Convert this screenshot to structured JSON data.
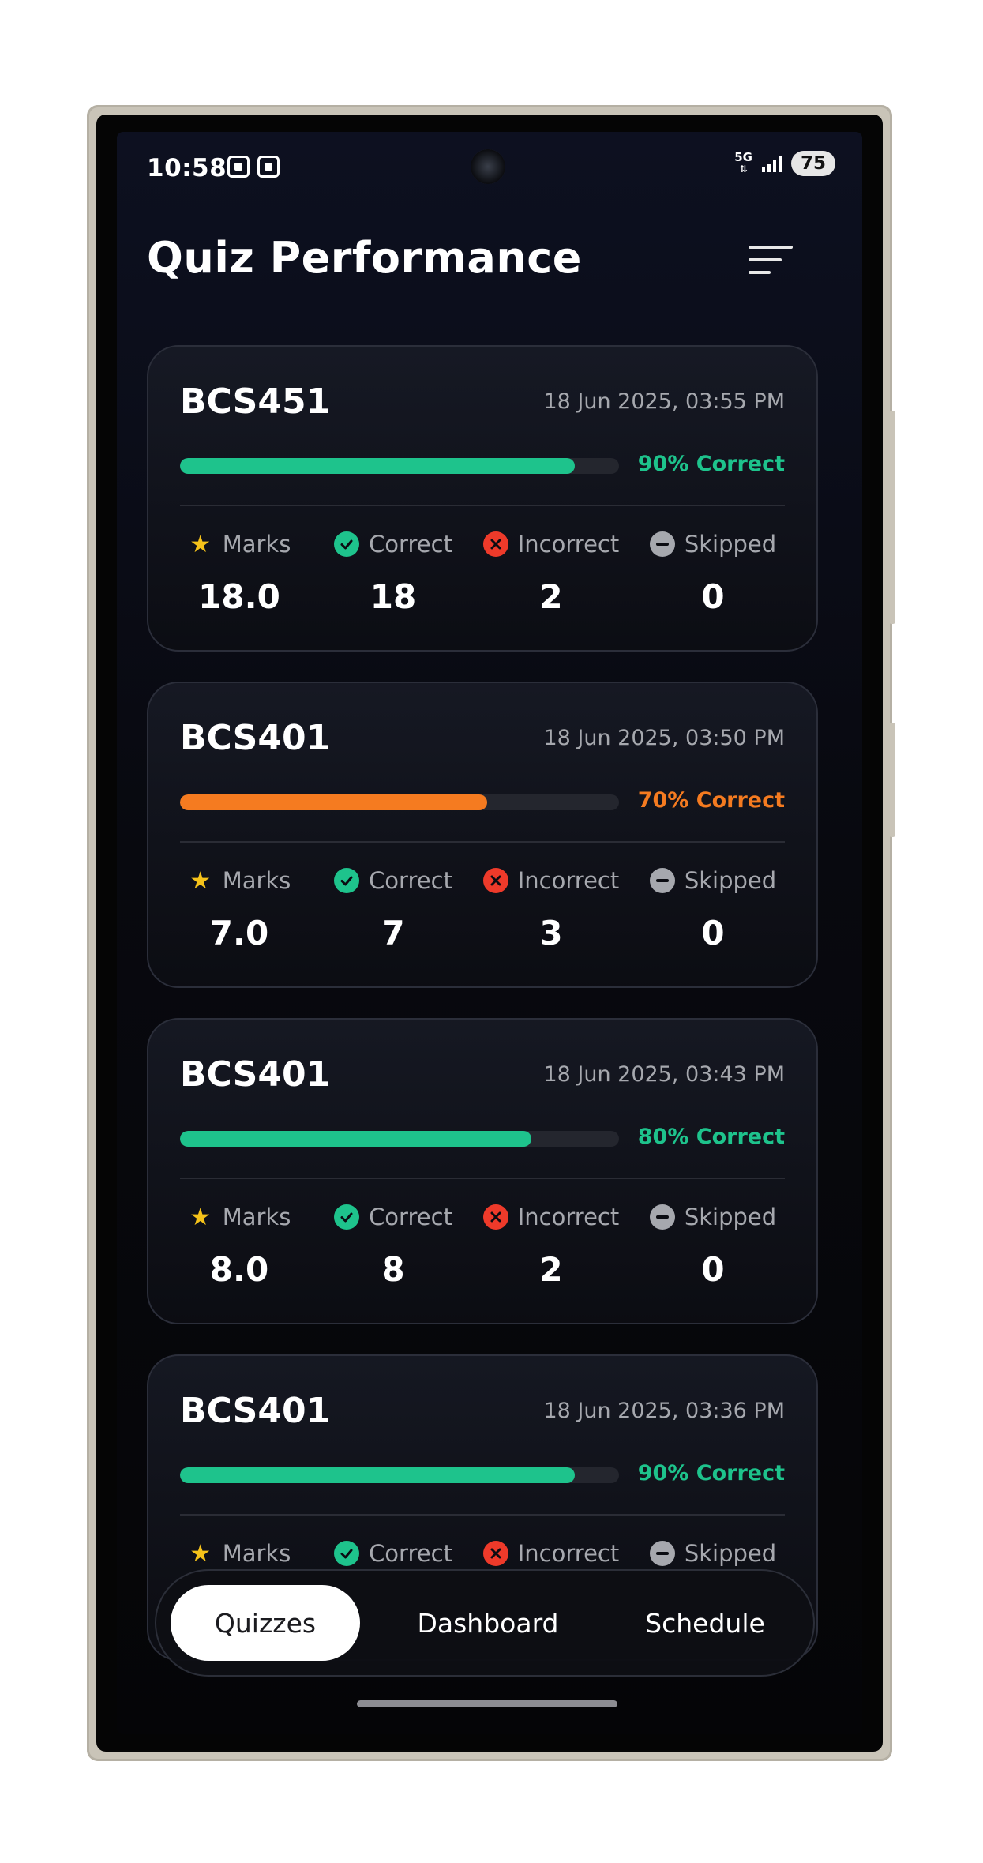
{
  "status_bar": {
    "time": "10:58",
    "network": "5G",
    "battery": "75"
  },
  "header": {
    "title": "Quiz Performance",
    "filter_icon": "filter-lines-icon"
  },
  "stat_labels": {
    "marks": "Marks",
    "correct": "Correct",
    "incorrect": "Incorrect",
    "skipped": "Skipped"
  },
  "colors": {
    "green": "#1ec38c",
    "orange": "#f57b20",
    "red": "#ee3a2a",
    "star": "#f5c21a"
  },
  "quizzes": [
    {
      "code": "BCS451",
      "date": "18 Jun 2025, 03:55 PM",
      "percent": 90,
      "progress_label": "90% Correct",
      "status": "green",
      "marks": "18.0",
      "correct": "18",
      "incorrect": "2",
      "skipped": "0"
    },
    {
      "code": "BCS401",
      "date": "18 Jun 2025, 03:50 PM",
      "percent": 70,
      "progress_label": "70% Correct",
      "status": "orange",
      "marks": "7.0",
      "correct": "7",
      "incorrect": "3",
      "skipped": "0"
    },
    {
      "code": "BCS401",
      "date": "18 Jun 2025, 03:43 PM",
      "percent": 80,
      "progress_label": "80% Correct",
      "status": "green",
      "marks": "8.0",
      "correct": "8",
      "incorrect": "2",
      "skipped": "0"
    },
    {
      "code": "BCS401",
      "date": "18 Jun 2025, 03:36 PM",
      "percent": 90,
      "progress_label": "90% Correct",
      "status": "green",
      "marks": "",
      "correct": "",
      "incorrect": "",
      "skipped": ""
    }
  ],
  "nav": {
    "tabs": [
      {
        "label": "Quizzes",
        "active": true
      },
      {
        "label": "Dashboard",
        "active": false
      },
      {
        "label": "Schedule",
        "active": false
      }
    ]
  }
}
